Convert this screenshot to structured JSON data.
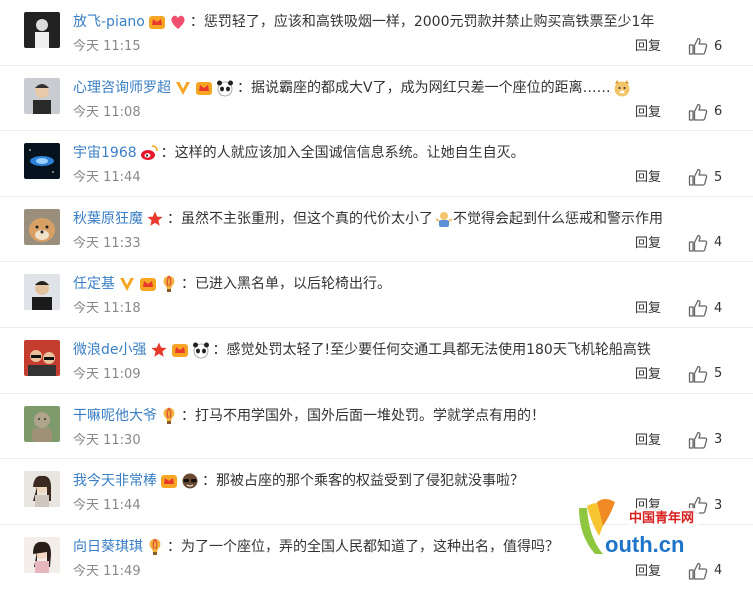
{
  "reply_label": "回复",
  "comments": [
    {
      "user": "放飞-piano",
      "text": "：惩罚轻了，应该和高铁吸烟一样，2000元罚款并禁止购买高铁票至少1年",
      "time": "今天 11:15",
      "likes": "6"
    },
    {
      "user": "心理咨询师罗超",
      "text": "：据说霸座的都成大V了，成为网红只差一个座位的距离……",
      "time": "今天 11:08",
      "likes": "6"
    },
    {
      "user": "宇宙1968",
      "text": "：这样的人就应该加入全国诚信信息系统。让她自生自灭。",
      "time": "今天 11:44",
      "likes": "5"
    },
    {
      "user": "秋葉原狂魔",
      "text": "：虽然不主张重刑，但这个真的代价太小了",
      "text2": "不觉得会起到什么惩戒和警示作用",
      "time": "今天 11:33",
      "likes": "4"
    },
    {
      "user": "任定基",
      "text": "：已进入黑名单，以后轮椅出行。",
      "time": "今天 11:18",
      "likes": "4"
    },
    {
      "user": "微浪de小强",
      "text": "：感觉处罚太轻了!至少要任何交通工具都无法使用180天飞机轮船高铁",
      "time": "今天 11:09",
      "likes": "5"
    },
    {
      "user": "干嘛呢他大爷",
      "text": "：打马不用学国外，国外后面一堆处罚。学就学点有用的！",
      "time": "今天 11:30",
      "likes": "3"
    },
    {
      "user": "我今天非常棒",
      "text": "：那被占座的那个乘客的权益受到了侵犯就没事啦？",
      "time": "今天 11:44",
      "likes": "3"
    },
    {
      "user": "向日葵琪琪",
      "text": "：为了一个座位，弄的全国人民都知道了，这种出名，值得吗？",
      "time": "今天 11:49",
      "likes": "4"
    }
  ],
  "watermark": {
    "brand": "中国青年网",
    "site": "outh.cn"
  }
}
